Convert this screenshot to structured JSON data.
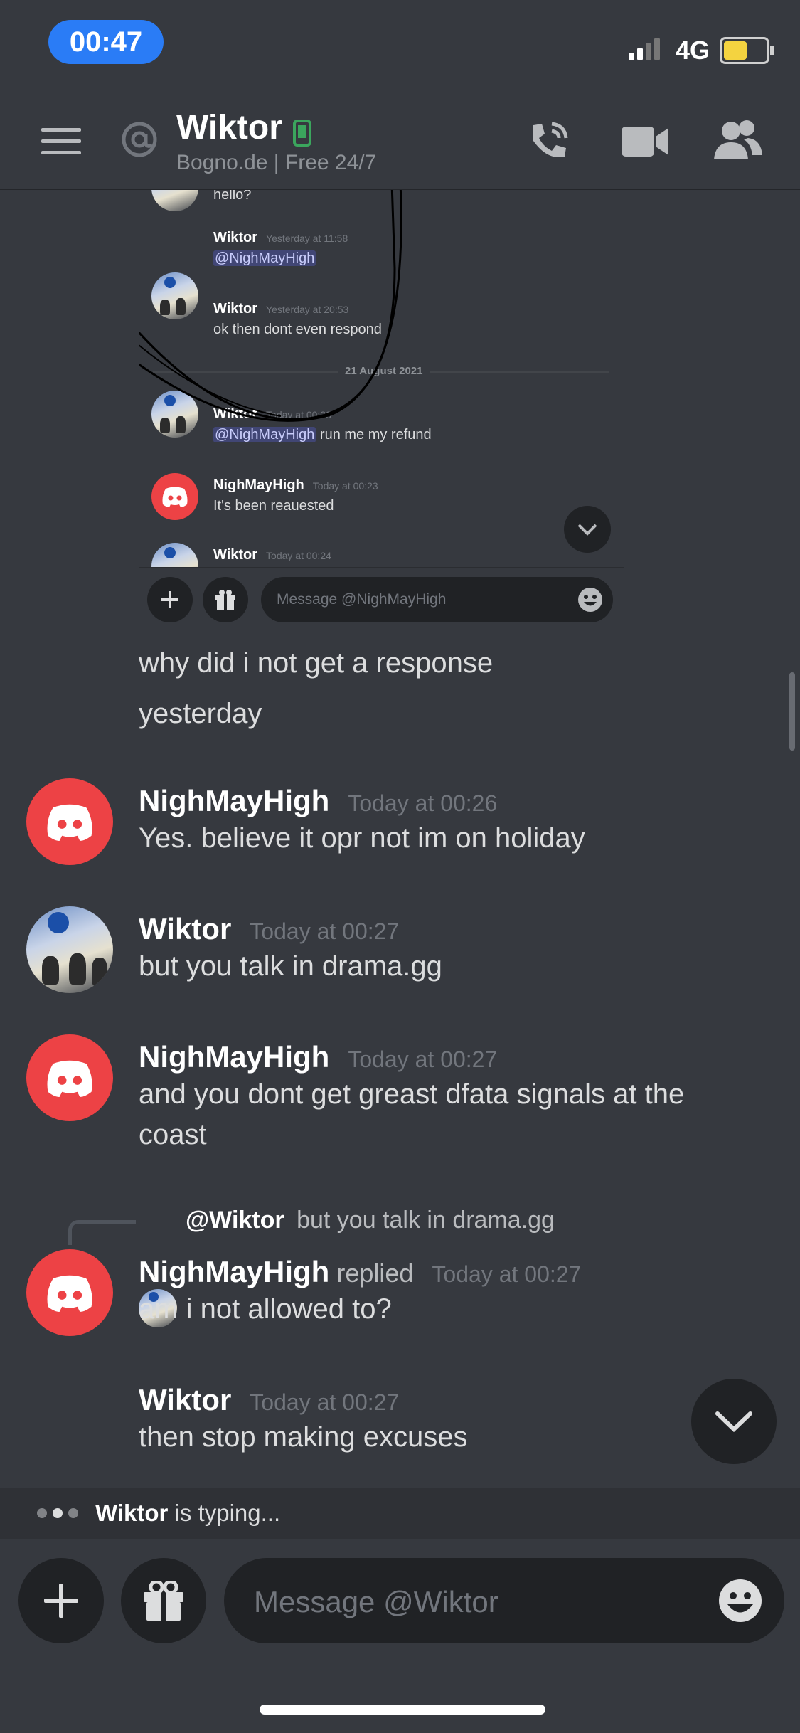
{
  "status_bar": {
    "time": "00:47",
    "network": "4G"
  },
  "header": {
    "title": "Wiktor",
    "subtitle": "Bogno.de  | Free 24/7"
  },
  "embed": {
    "partial_msg": "hello?",
    "messages": [
      {
        "name": "Wiktor",
        "time": "Yesterday at 11:58",
        "mention": "@NighMayHigh",
        "text": ""
      },
      {
        "name": "Wiktor",
        "time": "Yesterday at 20:53",
        "mention": "",
        "text": "ok then dont even respond"
      },
      {
        "name": "Wiktor",
        "time": "Today at 00:23",
        "mention": "@NighMayHigh",
        "text": " run me my refund"
      },
      {
        "name": "NighMayHigh",
        "time": "Today at 00:23",
        "mention": "",
        "text": "It's been reauested"
      },
      {
        "name": "Wiktor",
        "time": "Today at 00:24",
        "mention": "",
        "text": ""
      }
    ],
    "date_divider": "21 August 2021",
    "input_placeholder": "Message @NighMayHigh"
  },
  "continuation": {
    "line1": "why did i not get a response",
    "line2": "yesterday"
  },
  "messages": [
    {
      "name": "NighMayHigh",
      "time": "Today at 00:26",
      "line1": "Yes. believe it opr not im on holiday",
      "line2": ""
    },
    {
      "name": "Wiktor",
      "time": "Today at 00:27",
      "line1": "but you talk in drama.gg",
      "line2": ""
    },
    {
      "name": "NighMayHigh",
      "time": "Today at 00:27",
      "line1": "and you dont get greast dfata signals at the",
      "line2": "coast"
    },
    {
      "name": "NighMayHigh",
      "time": "Today at 00:27",
      "line1": "am i not allowed to?",
      "line2": "",
      "replied": "replied",
      "reply_to": "@Wiktor",
      "reply_text": "but you talk in drama.gg"
    },
    {
      "name": "Wiktor",
      "time": "Today at 00:27",
      "line1": "then stop making excuses",
      "line2": ""
    }
  ],
  "typing": {
    "name": "Wiktor",
    "text": " is typing..."
  },
  "composer": {
    "placeholder": "Message @Wiktor"
  },
  "colors": {
    "accent": "#5865f2",
    "discord_red": "#ed4245",
    "status_pill": "#2a7cf6"
  },
  "icons": [
    "menu-icon",
    "at-icon",
    "mobile-status-icon",
    "call-icon",
    "video-icon",
    "members-icon",
    "plus-icon",
    "gift-icon",
    "emoji-icon",
    "chevron-down-icon"
  ]
}
